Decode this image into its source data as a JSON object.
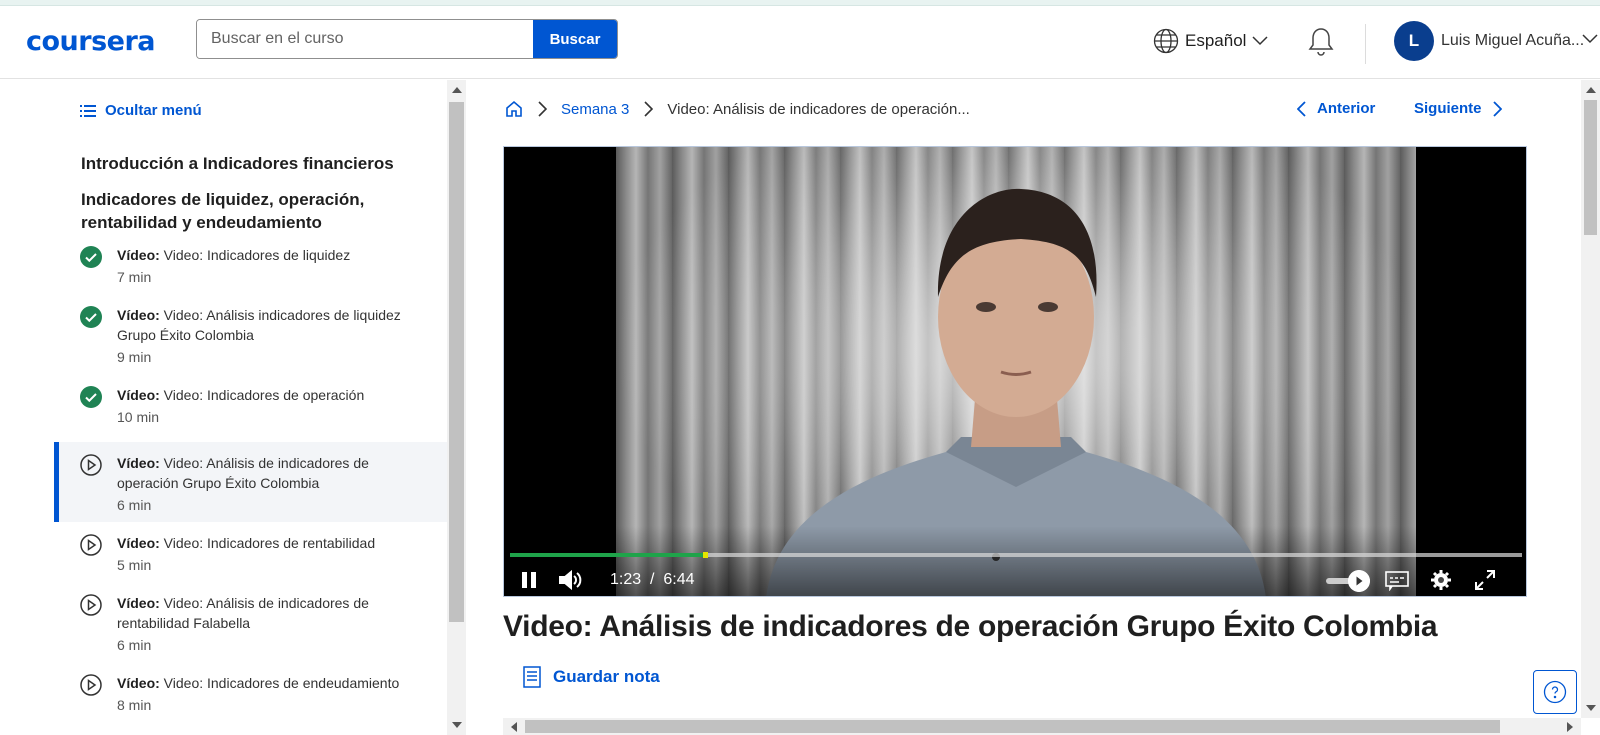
{
  "header": {
    "logo": "coursera",
    "search_placeholder": "Buscar en el curso",
    "search_button": "Buscar",
    "language": "Español",
    "user_initial": "L",
    "user_name": "Luis Miguel Acuña..."
  },
  "sidebar": {
    "hide_menu": "Ocultar menú",
    "module_title": "Introducción a Indicadores financieros",
    "section_title": "Indicadores de liquidez, operación, rentabilidad y endeudamiento",
    "items": [
      {
        "type": "Vídeo:",
        "title": "Video: Indicadores de liquidez",
        "duration": "7 min",
        "status": "completed"
      },
      {
        "type": "Vídeo:",
        "title": "Video: Análisis indicadores de liquidez Grupo Éxito Colombia",
        "duration": "9 min",
        "status": "completed"
      },
      {
        "type": "Vídeo:",
        "title": "Video: Indicadores de operación",
        "duration": "10 min",
        "status": "completed"
      },
      {
        "type": "Vídeo:",
        "title": "Video: Análisis de indicadores de operación Grupo Éxito Colombia",
        "duration": "6 min",
        "status": "active"
      },
      {
        "type": "Vídeo:",
        "title": "Video: Indicadores de rentabilidad",
        "duration": "5 min",
        "status": "pending"
      },
      {
        "type": "Vídeo:",
        "title": "Video: Análisis de indicadores de rentabilidad Falabella",
        "duration": "6 min",
        "status": "pending"
      },
      {
        "type": "Vídeo:",
        "title": "Video: Indicadores de endeudamiento",
        "duration": "8 min",
        "status": "pending"
      }
    ]
  },
  "breadcrumb": {
    "week": "Semana 3",
    "current": "Video: Análisis de indicadores de operación..."
  },
  "nav": {
    "prev": "Anterior",
    "next": "Siguiente"
  },
  "player": {
    "current_time": "1:23",
    "separator": "/",
    "duration": "6:44",
    "progress_fraction": 0.194
  },
  "content": {
    "title": "Video: Análisis de indicadores de operación Grupo Éxito Colombia",
    "save_note": "Guardar nota"
  },
  "colors": {
    "brand": "#0056d2",
    "completed": "#1f8354",
    "progress": "#1fa34a"
  }
}
